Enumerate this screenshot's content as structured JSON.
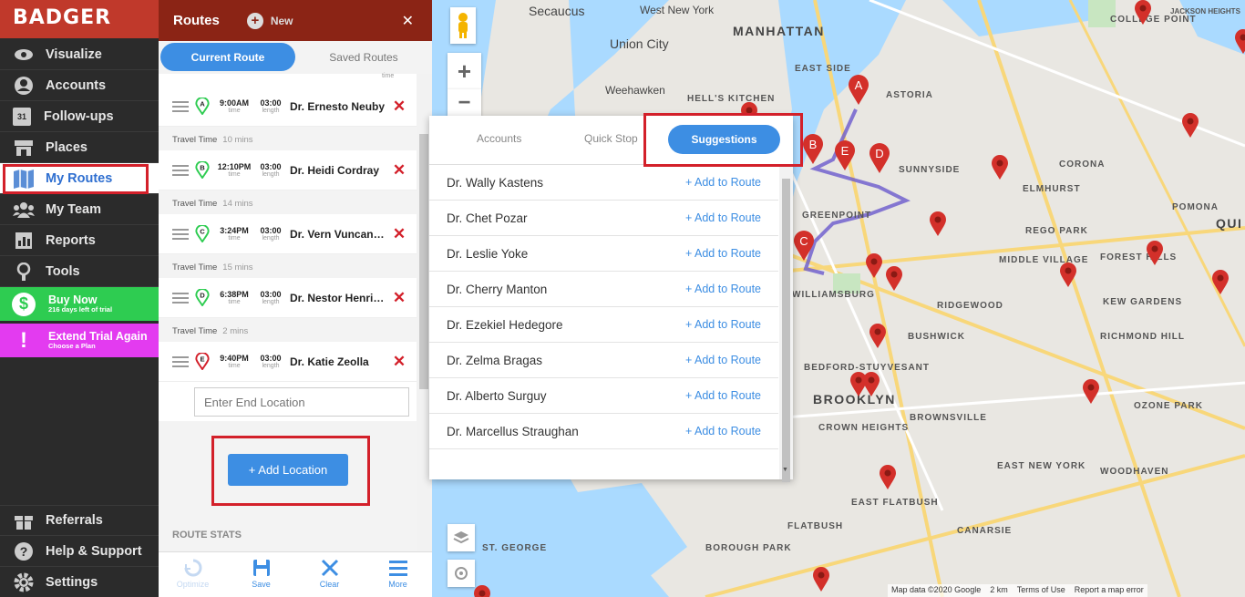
{
  "app": {
    "logo": "BADGER"
  },
  "nav": [
    {
      "label": "Visualize",
      "icon": "eye-icon"
    },
    {
      "label": "Accounts",
      "icon": "user-circle-icon"
    },
    {
      "label": "Follow-ups",
      "icon": "calendar-icon",
      "icon_text": "31"
    },
    {
      "label": "Places",
      "icon": "store-icon"
    },
    {
      "label": "My Routes",
      "icon": "map-icon",
      "active": true
    },
    {
      "label": "My Team",
      "icon": "team-icon"
    },
    {
      "label": "Reports",
      "icon": "report-icon"
    },
    {
      "label": "Tools",
      "icon": "tools-icon"
    }
  ],
  "promo": {
    "buy_title": "Buy Now",
    "buy_sub": "216 days left of trial",
    "buy_icon": "$",
    "trial_title": "Extend Trial Again",
    "trial_sub": "Choose a Plan",
    "trial_icon": "!"
  },
  "nav_bottom": [
    {
      "label": "Referrals",
      "icon": "gift-icon"
    },
    {
      "label": "Help & Support",
      "icon": "help-icon"
    },
    {
      "label": "Settings",
      "icon": "gear-icon"
    }
  ],
  "routes_panel": {
    "title": "Routes",
    "new_label": "New",
    "close_glyph": "✕",
    "tab_current": "Current Route",
    "tab_saved": "Saved Routes",
    "top_partial": "time",
    "time_caption": "time",
    "length_caption": "length",
    "travel_label": "Travel Time",
    "stops": [
      {
        "letter": "A",
        "time": "9:00AM",
        "length": "03:00",
        "name": "Dr. Ernesto Neuby",
        "color": "#2ecc51"
      },
      {
        "letter": "B",
        "time": "12:10PM",
        "length": "03:00",
        "name": "Dr. Heidi Cordray",
        "color": "#2ecc51"
      },
      {
        "letter": "C",
        "time": "3:24PM",
        "length": "03:00",
        "name": "Dr. Vern Vuncannon",
        "color": "#2ecc51"
      },
      {
        "letter": "D",
        "time": "6:38PM",
        "length": "03:00",
        "name": "Dr. Nestor Henrickson",
        "color": "#2ecc51"
      },
      {
        "letter": "E",
        "time": "9:40PM",
        "length": "03:00",
        "name": "Dr. Katie Zeolla",
        "color": "#d3202a"
      }
    ],
    "travel_times": [
      "10 mins",
      "14 mins",
      "15 mins",
      "2 mins"
    ],
    "end_placeholder": "Enter End Location",
    "add_location": "+ Add Location",
    "route_stats": "ROUTE STATS",
    "bottom": [
      {
        "label": "Optimize",
        "icon": "optimize-icon",
        "disabled": true
      },
      {
        "label": "Save",
        "icon": "save-icon"
      },
      {
        "label": "Clear",
        "icon": "clear-icon"
      },
      {
        "label": "More",
        "icon": "menu-icon"
      }
    ]
  },
  "suggestions": {
    "tabs": [
      "Accounts",
      "Quick Stop",
      "Suggestions"
    ],
    "active_tab": "Suggestions",
    "add_label": "+ Add to Route",
    "items": [
      "Dr. Wally Kastens",
      "Dr. Chet Pozar",
      "Dr. Leslie Yoke",
      "Dr. Cherry Manton",
      "Dr. Ezekiel Hedegore",
      "Dr. Zelma Bragas",
      "Dr. Alberto Surguy",
      "Dr. Marcellus Straughan"
    ]
  },
  "map": {
    "labels": [
      "Secaucus",
      "West New York",
      "Union City",
      "Weehawken",
      "MANHATTAN",
      "EAST SIDE",
      "HELL'S KITCHEN",
      "ASTORIA",
      "SUNNYSIDE",
      "CORONA",
      "ELMHURST",
      "GREENPOINT",
      "REGO PARK",
      "MIDDLE VILLAGE",
      "FOREST HILLS",
      "WILLIAMSBURG",
      "RIDGEWOOD",
      "KEW GARDENS",
      "BUSHWICK",
      "RICHMOND HILL",
      "BEDFORD-STUYVESANT",
      "BROOKLYN",
      "OZONE PARK",
      "CROWN HEIGHTS",
      "BROWNSVILLE",
      "EAST NEW YORK",
      "WOODHAVEN",
      "EAST FLATBUSH",
      "FLATBUSH",
      "CANARSIE",
      "BOROUGH PARK",
      "ST. GEORGE",
      "COLLEGE POINT",
      "POMONA",
      "QUI",
      "JACKSON HEIGHTS"
    ],
    "route_letters": [
      "A",
      "B",
      "E",
      "D",
      "C"
    ],
    "footer": [
      "Map data ©2020 Google",
      "2 km",
      "Terms of Use",
      "Report a map error"
    ],
    "zoom_in": "+",
    "zoom_out": "−"
  },
  "colors": {
    "brand": "#c0392b",
    "accent": "#3d8ee3",
    "danger": "#d3202a",
    "route": "#6a5acd"
  }
}
